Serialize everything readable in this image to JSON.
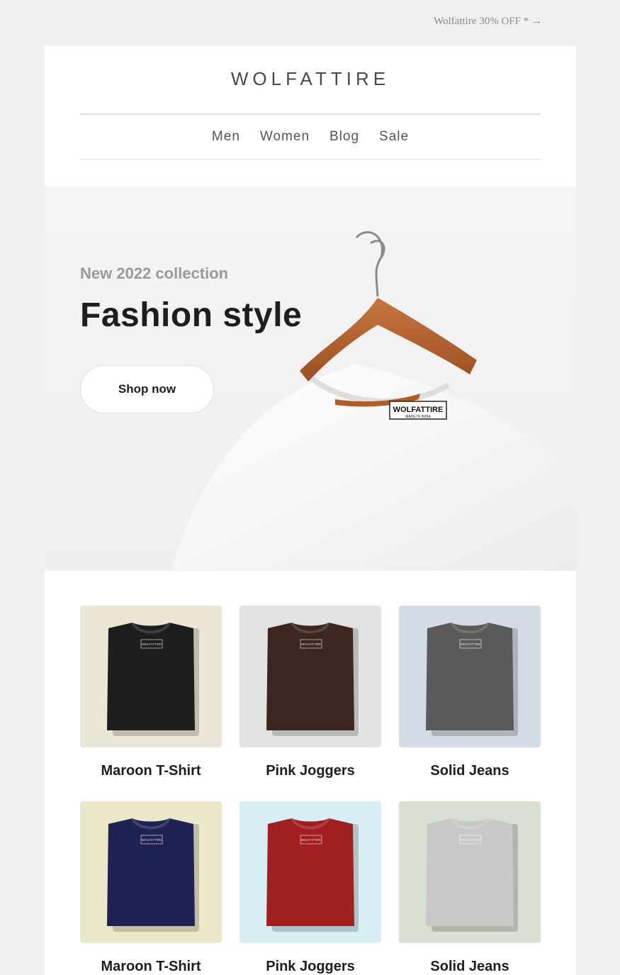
{
  "preheader": {
    "text": "Wolfattire 30% OFF * →"
  },
  "header": {
    "logo": "WOLFATTIRE",
    "nav": [
      {
        "label": "Men"
      },
      {
        "label": "Women"
      },
      {
        "label": "Blog"
      },
      {
        "label": "Sale"
      }
    ]
  },
  "hero": {
    "eyebrow": "New 2022 collection",
    "title": "Fashion style",
    "button_label": "Shop now",
    "tag_label": "WOLFATTIRE",
    "tag_sub": "MADE IN INDIA",
    "colors": {
      "shirt": "#fbfbfb",
      "hanger": "#b8642f"
    }
  },
  "products": [
    {
      "name": "Maroon T-Shirt",
      "shirt_color": "#1e1e1e",
      "bg_color": "#ece6d6"
    },
    {
      "name": "Pink Joggers",
      "shirt_color": "#3d261d",
      "bg_color": "#e3e3e3"
    },
    {
      "name": "Solid Jeans",
      "shirt_color": "#5a5a58",
      "bg_color": "#d3dbe6"
    },
    {
      "name": "Maroon T-Shirt",
      "shirt_color": "#1f2354",
      "bg_color": "#ebe7c9"
    },
    {
      "name": "Pink Joggers",
      "shirt_color": "#a11f21",
      "bg_color": "#d6eef4"
    },
    {
      "name": "Solid Jeans",
      "shirt_color": "#c8c8c8",
      "bg_color": "#d7e0d2"
    }
  ],
  "product_tag": "WOLFATTIRE"
}
